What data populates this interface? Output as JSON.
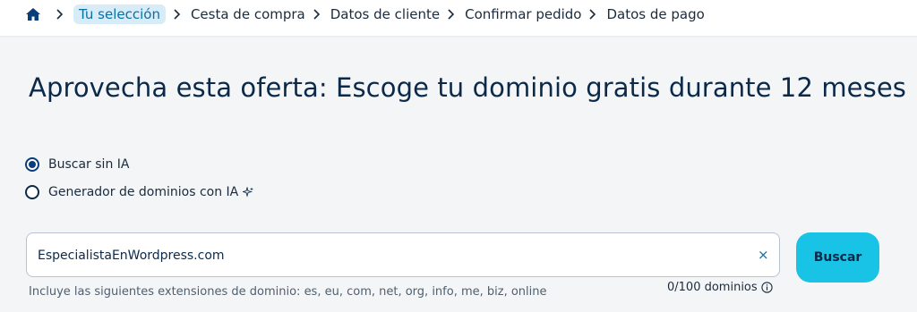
{
  "breadcrumb": {
    "home_icon": "home-icon",
    "items": [
      {
        "label": "Tu selección",
        "active": true
      },
      {
        "label": "Cesta de compra",
        "active": false
      },
      {
        "label": "Datos de cliente",
        "active": false
      },
      {
        "label": "Confirmar pedido",
        "active": false
      },
      {
        "label": "Datos de pago",
        "active": false
      }
    ]
  },
  "page": {
    "title": "Aprovecha esta oferta: Escoge tu dominio gratis durante 12 meses"
  },
  "search_mode": {
    "options": [
      {
        "label": "Buscar sin IA",
        "selected": true
      },
      {
        "label": "Generador de dominios con IA",
        "selected": false,
        "icon": "sparkle-icon"
      }
    ]
  },
  "search": {
    "value": "EspecialistaEnWordpress.com",
    "clear_icon": "close-icon",
    "clear_glyph": "×",
    "button_label": "Buscar",
    "helper_text": "Incluye las siguientes extensiones de dominio: es, eu, com, net, org, info, me, biz, online",
    "counter_text": "0/100 dominios",
    "counter_icon": "info-icon"
  },
  "colors": {
    "accent": "#19c3e6",
    "active_crumb_bg": "#d7ecf7",
    "active_crumb_text": "#0b6fa4",
    "title_text": "#0b2a4a"
  }
}
